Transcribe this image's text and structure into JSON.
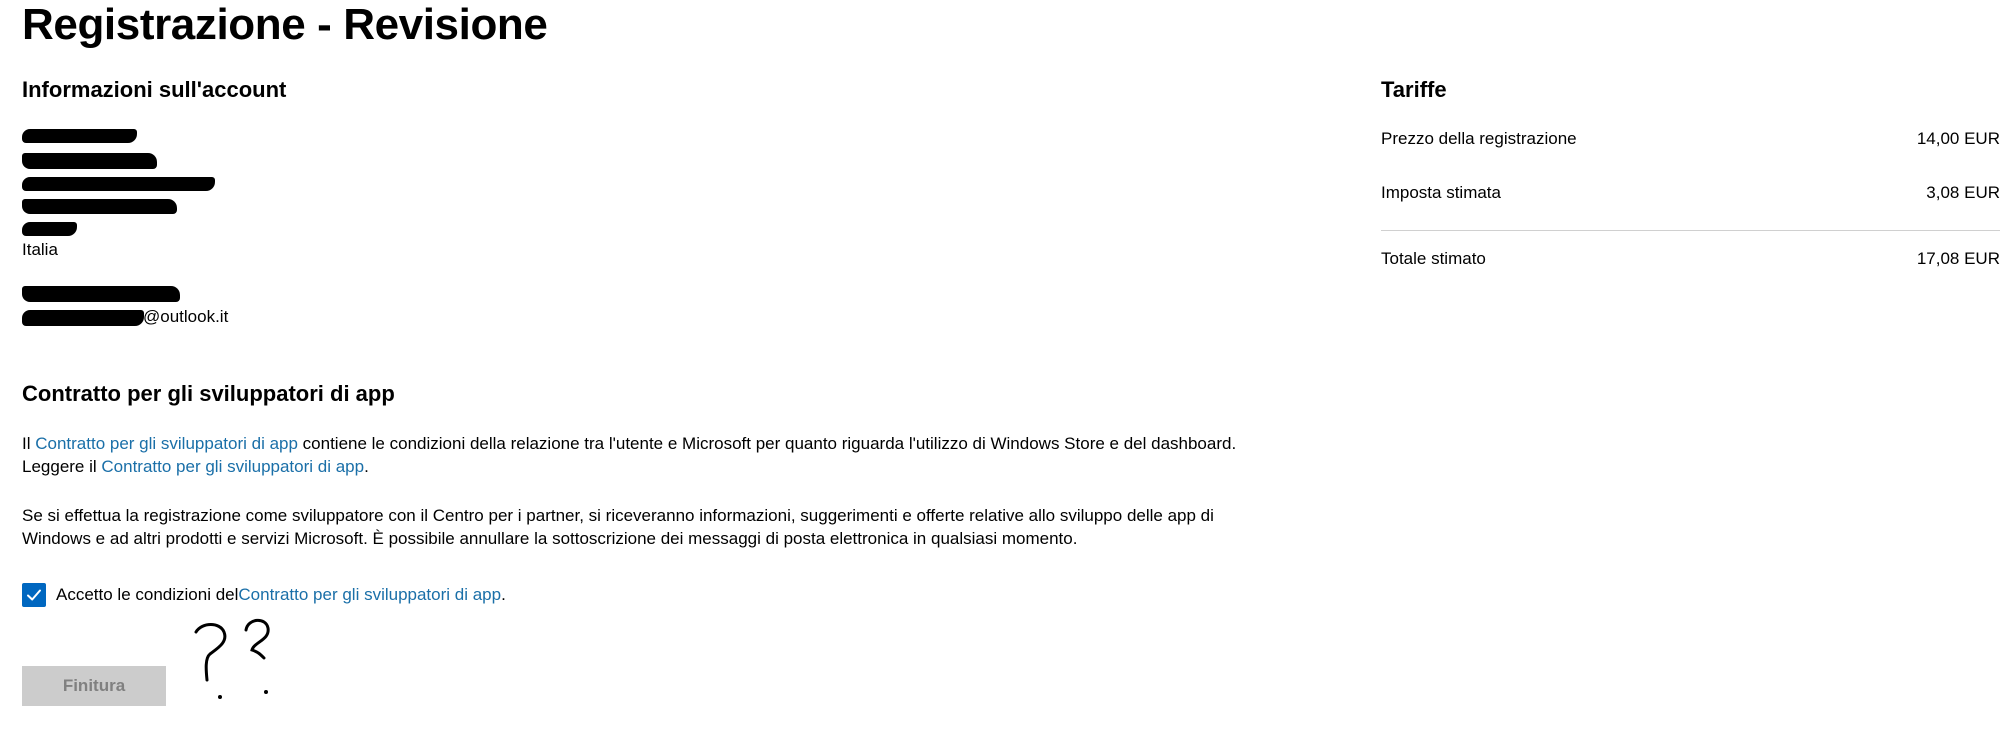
{
  "page": {
    "title": "Registrazione - Revisione"
  },
  "account": {
    "heading": "Informazioni sull'account",
    "country": "Italia",
    "email_suffix": "@outlook.it"
  },
  "agreement": {
    "heading": "Contratto per gli sviluppatori di app",
    "p1_prefix": "Il ",
    "p1_link": "Contratto per gli sviluppatori di app",
    "p1_suffix": " contiene le condizioni della relazione tra l'utente e Microsoft per quanto riguarda l'utilizzo di Windows Store e del dashboard.",
    "p1_line2_prefix": "Leggere il ",
    "p1_line2_link": "Contratto per gli sviluppatori di app",
    "p1_line2_suffix": ".",
    "p2_line1": "Se si effettua la registrazione come sviluppatore con il Centro per i partner, si riceveranno informazioni, suggerimenti e offerte relative allo sviluppo delle app di",
    "p2_line2": "Windows e ad altri prodotti e servizi Microsoft. È possibile annullare la sottoscrizione dei messaggi di posta elettronica in qualsiasi momento.",
    "checkbox_checked": true,
    "checkbox_prefix": "Accetto le condizioni del ",
    "checkbox_link": "Contratto per gli sviluppatori di app",
    "checkbox_suffix": "."
  },
  "finish_button": {
    "label": "Finitura",
    "disabled": true
  },
  "fees": {
    "heading": "Tariffe",
    "rows": [
      {
        "label": "Prezzo della registrazione",
        "value": "14,00 EUR"
      },
      {
        "label": "Imposta stimata",
        "value": "3,08 EUR"
      }
    ],
    "total": {
      "label": "Totale stimato",
      "value": "17,08 EUR"
    }
  },
  "annotation": {
    "text": "??"
  },
  "colors": {
    "link": "#1a6fa8",
    "checkbox": "#0067c0",
    "button_disabled_bg": "#cccccc",
    "button_disabled_text": "#808080",
    "divider": "#d0d0d0"
  },
  "icons": {
    "checkbox": "checkmark-icon"
  }
}
